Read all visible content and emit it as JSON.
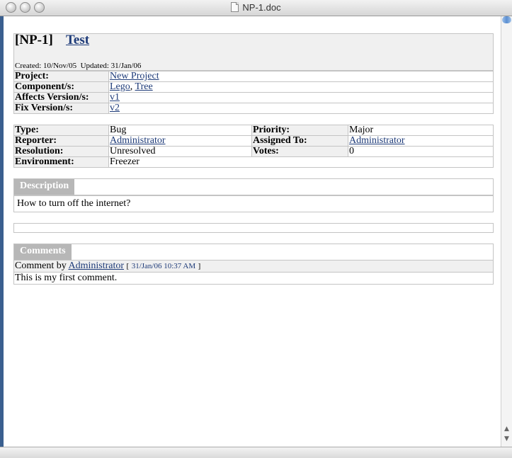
{
  "window": {
    "title": "NP-1.doc"
  },
  "issue": {
    "key": "[NP-1]",
    "summary": "Test",
    "created_label": "Created:",
    "created": "10/Nov/05",
    "updated_label": "Updated:",
    "updated": "31/Jan/06"
  },
  "meta": {
    "project_label": "Project:",
    "project": "New Project",
    "components_label": "Component/s:",
    "components": [
      "Lego",
      "Tree"
    ],
    "component_sep": ",",
    "affects_label": "Affects Version/s:",
    "affects": "v1",
    "fix_label": "Fix Version/s:",
    "fix": "v2"
  },
  "details": {
    "type_label": "Type:",
    "type": "Bug",
    "priority_label": "Priority:",
    "priority": "Major",
    "reporter_label": "Reporter:",
    "reporter": "Administrator",
    "assignee_label": "Assigned To:",
    "assignee": "Administrator",
    "resolution_label": "Resolution:",
    "resolution": "Unresolved",
    "votes_label": "Votes:",
    "votes": "0",
    "environment_label": "Environment:",
    "environment": "Freezer"
  },
  "description": {
    "heading": "Description",
    "text": "How to turn off the internet?"
  },
  "comments": {
    "heading": "Comments",
    "by_label": "Comment by",
    "author": "Administrator",
    "open_bracket": "[",
    "date": "31/Jan/06 10:37 AM",
    "close_bracket": "]",
    "text": "This is my first comment."
  },
  "scroll": {
    "up_icon": "chevron-up-icon",
    "down_icon": "chevron-down-icon"
  }
}
